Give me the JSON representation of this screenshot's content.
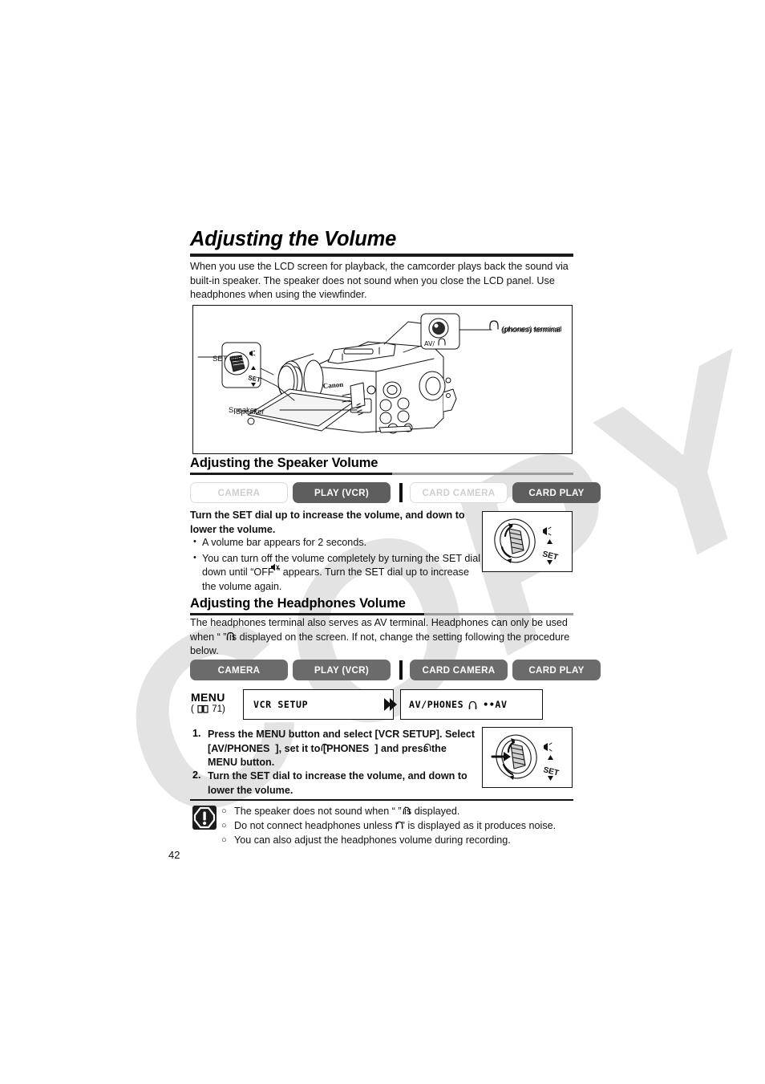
{
  "page": {
    "number": "42",
    "watermark": "COPY"
  },
  "title": "Adjusting the Volume",
  "intro": "When you use the LCD screen for playback, the camcorder plays back the sound via built-in speaker. The speaker does not sound when you close the LCD panel. Use headphones when using the viewfinder.",
  "figure": {
    "callouts": {
      "phones_terminal": "(phones) terminal",
      "set_dial": "SET dial",
      "speaker": "Speaker",
      "av_phones_port": "AV/",
      "brand": "Canon"
    }
  },
  "speaker_section": {
    "heading": "Adjusting the Speaker Volume",
    "modes": [
      {
        "label": "CAMERA",
        "active": false
      },
      {
        "label": "PLAY (VCR)",
        "active": true
      },
      {
        "label": "CARD CAMERA",
        "active": false
      },
      {
        "label": "CARD PLAY",
        "active": true
      }
    ],
    "instruction": "Turn the SET dial up to increase the volume, and down to lower the volume.",
    "bullets": [
      "A volume bar appears for 2 seconds.",
      "You can turn off the volume completely by turning the SET dial down until “OFF     ” appears. Turn the SET dial up to increase the volume again."
    ],
    "dial_labels": {
      "volume": "volume-icon",
      "set": "SET"
    }
  },
  "headphones_section": {
    "heading": "Adjusting the Headphones Volume",
    "intro": "The headphones terminal also serves as AV terminal. Headphones can only be used when “    ” is displayed on the screen. If not, change the setting following the procedure below.",
    "modes": [
      {
        "label": "CAMERA",
        "active": true
      },
      {
        "label": "PLAY (VCR)",
        "active": true
      },
      {
        "label": "CARD CAMERA",
        "active": true
      },
      {
        "label": "CARD PLAY",
        "active": true
      }
    ],
    "menu": {
      "label": "MENU",
      "ref": "( 71)",
      "ref_page": "71",
      "box1": "VCR  SETUP",
      "box2_prefix": "AV/PHONES",
      "box2_suffix": "••AV"
    },
    "steps": [
      {
        "num": "1.",
        "text": "Press the MENU button and select [VCR SETUP]. Select [AV/PHONES  ], set it to [PHONES  ] and press the MENU button."
      },
      {
        "num": "2.",
        "text": "Turn the SET dial to increase the volume, and down to lower the volume."
      }
    ]
  },
  "notes": {
    "icon": "warning-icon",
    "items": [
      "The speaker does not sound when “    ” is displayed.",
      "Do not connect headphones unless “    ” is displayed as it produces noise.",
      "You can also adjust the headphones volume during recording."
    ]
  }
}
